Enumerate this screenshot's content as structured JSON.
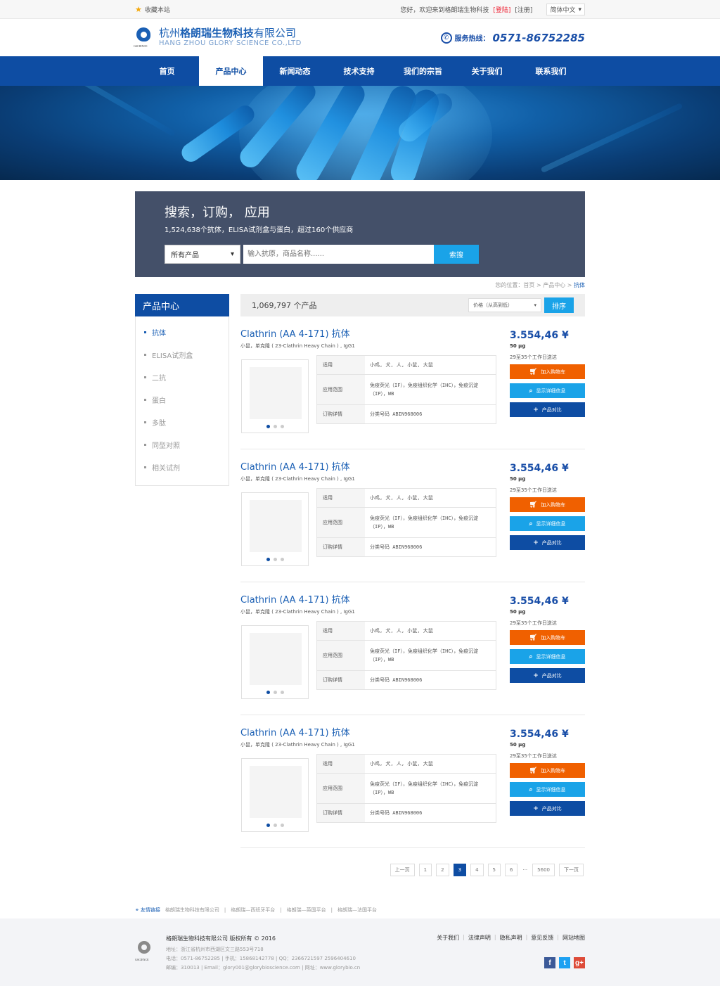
{
  "topbar": {
    "favorite": "收藏本站",
    "welcome": "您好，欢迎来到格朗瑞生物科技",
    "login": "[登陆]",
    "register": "[注册]",
    "language": "简体中文"
  },
  "header": {
    "logo_sub": "GSCIENCE",
    "name_prefix": "杭州",
    "name_bold": "格朗瑞生物科技",
    "name_suffix": "有限公司",
    "name_en": "HANG ZHOU GLORY SCIENCE CO.,LTD",
    "hotline_label": "服务热线：",
    "hotline_number": "0571-86752285"
  },
  "nav": [
    {
      "label": "首页"
    },
    {
      "label": "产品中心"
    },
    {
      "label": "新闻动态"
    },
    {
      "label": "技术支持"
    },
    {
      "label": "我们的宗旨"
    },
    {
      "label": "关于我们"
    },
    {
      "label": "联系我们"
    }
  ],
  "search": {
    "title": "搜索，订购， 应用",
    "subtitle": "1,524,638个抗体，ELISA试剂盒与蛋白，超过160个供应商",
    "category": "所有产品",
    "placeholder": "输入抗原，商品名称......",
    "button": "索搜"
  },
  "breadcrumb": {
    "prefix": "您的位置：首页 > 产品中心 > ",
    "current": "抗体"
  },
  "sidebar": {
    "title": "产品中心",
    "items": [
      {
        "label": "抗体"
      },
      {
        "label": "ELISA试剂盒"
      },
      {
        "label": "二抗"
      },
      {
        "label": "蛋白"
      },
      {
        "label": "多肽"
      },
      {
        "label": "同型对照"
      },
      {
        "label": "相关试剂"
      }
    ]
  },
  "results": {
    "count": "1,069,797 个产品",
    "sort_option": "价格（从高到低）",
    "sort_button": "排序"
  },
  "products": [
    {
      "title": "Clathrin (AA 4-171) 抗体",
      "subtitle": "小鼠，单克隆 ( 23-Clathrin Heavy Chain ) , IgG1",
      "k1": "适用",
      "v1": "小鸡, 犬, 人, 小鼠, 大鼠",
      "k2": "应用范围",
      "v2": "免疫荧光（IF），免疫组织化学（IHC），免疫沉淀（IP），WB",
      "k3": "订购详情",
      "v3": "分类号码 ABIN968006",
      "price": "3.554,46 ¥",
      "qty": "50 μg",
      "delivery": "29至35个工作日送达",
      "cart": "加入购物车",
      "detail": "显示详细信息",
      "compare": "产品对比"
    },
    {
      "title": "Clathrin (AA 4-171) 抗体",
      "subtitle": "小鼠，单克隆 ( 23-Clathrin Heavy Chain ) , IgG1",
      "k1": "适用",
      "v1": "小鸡, 犬, 人, 小鼠, 大鼠",
      "k2": "应用范围",
      "v2": "免疫荧光（IF），免疫组织化学（IHC），免疫沉淀（IP），WB",
      "k3": "订购详情",
      "v3": "分类号码 ABIN968006",
      "price": "3.554,46 ¥",
      "qty": "50 μg",
      "delivery": "29至35个工作日送达",
      "cart": "加入购物车",
      "detail": "显示详细信息",
      "compare": "产品对比"
    },
    {
      "title": "Clathrin (AA 4-171) 抗体",
      "subtitle": "小鼠，单克隆 ( 23-Clathrin Heavy Chain ) , IgG1",
      "k1": "适用",
      "v1": "小鸡, 犬, 人, 小鼠, 大鼠",
      "k2": "应用范围",
      "v2": "免疫荧光（IF），免疫组织化学（IHC），免疫沉淀（IP），WB",
      "k3": "订购详情",
      "v3": "分类号码 ABIN968006",
      "price": "3.554,46 ¥",
      "qty": "50 μg",
      "delivery": "29至35个工作日送达",
      "cart": "加入购物车",
      "detail": "显示详细信息",
      "compare": "产品对比"
    },
    {
      "title": "Clathrin (AA 4-171) 抗体",
      "subtitle": "小鼠，单克隆 ( 23-Clathrin Heavy Chain ) , IgG1",
      "k1": "适用",
      "v1": "小鸡, 犬, 人, 小鼠, 大鼠",
      "k2": "应用范围",
      "v2": "免疫荧光（IF），免疫组织化学（IHC），免疫沉淀（IP），WB",
      "k3": "订购详情",
      "v3": "分类号码 ABIN968006",
      "price": "3.554,46 ¥",
      "qty": "50 μg",
      "delivery": "29至35个工作日送达",
      "cart": "加入购物车",
      "detail": "显示详细信息",
      "compare": "产品对比"
    }
  ],
  "pagination": {
    "prev": "上一页",
    "pages": [
      "1",
      "2",
      "3",
      "4",
      "5",
      "6"
    ],
    "ellipsis": "···",
    "last": "5600",
    "next": "下一页"
  },
  "friend_links": {
    "title": "友情链接",
    "items": [
      "格朗瑞生物科技有限公司",
      "格朗瑞—西班牙平台",
      "格朗瑞—英国平台",
      "格朗瑞—法国平台"
    ]
  },
  "footer": {
    "logo_sub": "GSCIENCE",
    "copyright": "格朗瑞生物科技有限公司 版权所有 © 2016",
    "address": "地址：浙江省杭州市西湖区文三路553号718",
    "phones": "电话：0571-86752285  |  手机：15868142778  |  QQ：2366721597  2596404610",
    "contact": "邮编：310013  |  Email：glory001@glorybioscience.com  |  网址：www.glorybio.cn",
    "links": [
      "关于我们",
      "法律声明",
      "隐私声明",
      "意见反馈",
      "网站地图"
    ],
    "social": [
      "f",
      "t",
      "g+"
    ]
  },
  "colors": {
    "brand_blue": "#0e4da3",
    "accent_cyan": "#1aa3e8",
    "cart_orange": "#f06000",
    "search_panel": "#445069"
  }
}
